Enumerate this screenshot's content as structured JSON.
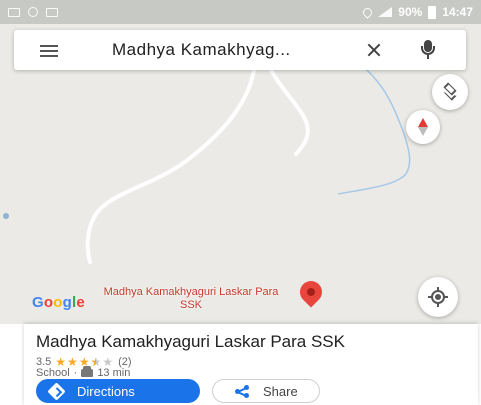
{
  "status_bar": {
    "battery_percent": "90%",
    "time": "14:47"
  },
  "search": {
    "query": "Madhya Kamakhyag..."
  },
  "map": {
    "place_label": "Madhya Kamakhyaguri Laskar Para SSK",
    "logo_text": "Google"
  },
  "place": {
    "title": "Madhya Kamakhyaguri Laskar Para SSK",
    "rating": "3.5",
    "rating_value": 3.5,
    "review_count": "(2)",
    "category": "School",
    "separator": "·",
    "drive_time": "13 min"
  },
  "actions": {
    "directions_label": "Directions",
    "share_label": "Share"
  },
  "colors": {
    "accent": "#1a73e8",
    "pin": "#e8453c",
    "star": "#f9a825",
    "map_bg": "#ebeae6"
  },
  "icons": {
    "menu": "menu-icon",
    "clear": "close-icon",
    "voice": "mic-icon",
    "layers": "layers-icon",
    "compass": "compass-icon",
    "location": "my-location-icon",
    "directions": "directions-icon",
    "share": "share-icon",
    "drive": "car-icon"
  }
}
